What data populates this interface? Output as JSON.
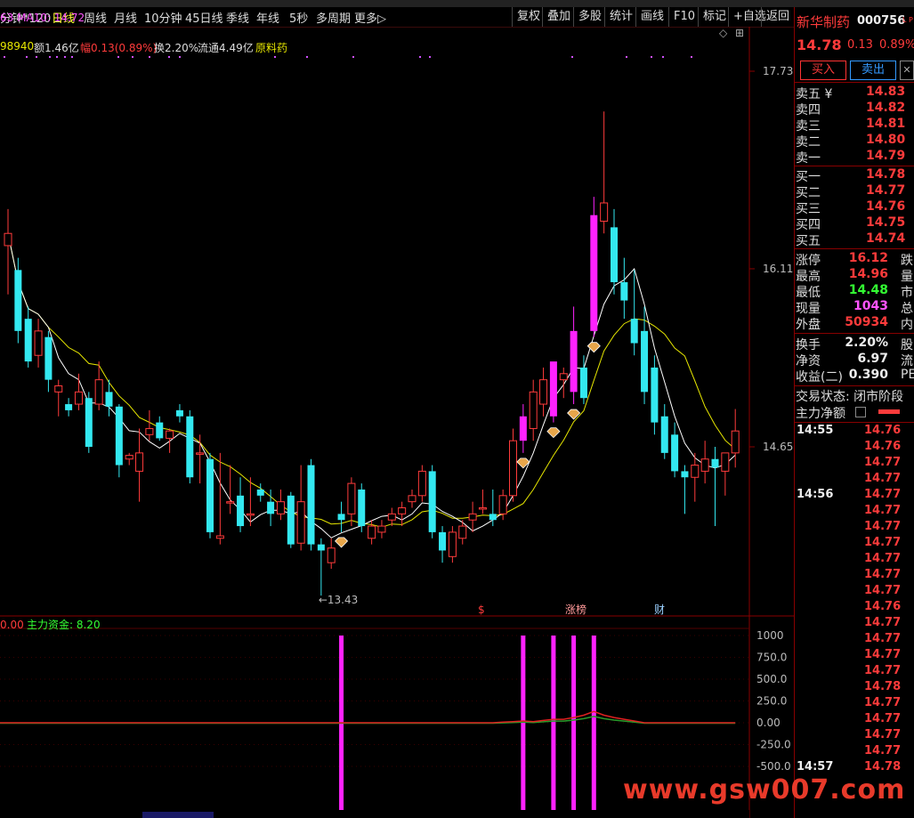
{
  "toolbar": {
    "periods": [
      "分钟*120",
      "日线",
      "周线",
      "月线",
      "10分钟",
      "45日线",
      "季线",
      "年线",
      "5秒",
      "多周期",
      "更多▷"
    ],
    "active_period": "日线",
    "right_buttons": [
      "复权",
      "叠加",
      "多股",
      "统计",
      "画线",
      "F10",
      "标记",
      "+自选",
      "返回"
    ]
  },
  "info": {
    "vol_fragment": "98940",
    "amount": "额1.46亿",
    "change": "幅0.13(0.89%)",
    "turnover": "换2.20%",
    "float": "流通4.49亿",
    "sector": "原料药",
    "ma_line": "63  MA10: 14.72",
    "diamond": "◇",
    "grid_icon": "⊞"
  },
  "main_chart": {
    "y_labels": [
      "17.73",
      "16.11",
      "14.65"
    ],
    "low_label": "←13.43",
    "markers": [
      "$",
      "涨榜",
      "财"
    ]
  },
  "indicator": {
    "header_left": "0.00",
    "header_name": "主力资金: 8.20",
    "y_labels": [
      "1000",
      "750.0",
      "500.0",
      "250.0",
      "0.00",
      "-250.0",
      "-500.0"
    ]
  },
  "stock": {
    "name": "新华制药",
    "code": "000756",
    "code_suffix": "L P",
    "price": "14.78",
    "change": "0.13",
    "change_pct": "0.89%",
    "buy_label": "买入",
    "sell_label": "卖出",
    "sells": [
      {
        "label": "卖五 ¥",
        "price": "14.83"
      },
      {
        "label": "卖四",
        "price": "14.82"
      },
      {
        "label": "卖三",
        "price": "14.81"
      },
      {
        "label": "卖二",
        "price": "14.80"
      },
      {
        "label": "卖一",
        "price": "14.79"
      }
    ],
    "buys": [
      {
        "label": "买一",
        "price": "14.78"
      },
      {
        "label": "买二",
        "price": "14.77"
      },
      {
        "label": "买三",
        "price": "14.76"
      },
      {
        "label": "买四",
        "price": "14.75"
      },
      {
        "label": "买五",
        "price": "14.74"
      }
    ],
    "stats": [
      {
        "label": "涨停",
        "value": "16.12",
        "tag": "跌"
      },
      {
        "label": "最高",
        "value": "14.96",
        "tag": "量"
      },
      {
        "label": "最低",
        "value": "14.48",
        "tag": "市"
      },
      {
        "label": "现量",
        "value": "1043",
        "tag": "总"
      },
      {
        "label": "外盘",
        "value": "50934",
        "tag": "内"
      }
    ],
    "stats2": [
      {
        "label": "换手",
        "value": "2.20%",
        "tag": "股"
      },
      {
        "label": "净资",
        "value": "6.97",
        "tag": "流"
      },
      {
        "label": "收益(二)",
        "value": "0.390",
        "tag": "PE"
      }
    ],
    "trade_status": "交易状态: 闭市阶段",
    "main_net": "主力净额"
  },
  "ticks": [
    {
      "time": "14:55",
      "price": "14.76"
    },
    {
      "time": "",
      "price": "14.76"
    },
    {
      "time": "",
      "price": "14.77"
    },
    {
      "time": "",
      "price": "14.77"
    },
    {
      "time": "14:56",
      "price": "14.77"
    },
    {
      "time": "",
      "price": "14.77"
    },
    {
      "time": "",
      "price": "14.77"
    },
    {
      "time": "",
      "price": "14.77"
    },
    {
      "time": "",
      "price": "14.77"
    },
    {
      "time": "",
      "price": "14.77"
    },
    {
      "time": "",
      "price": "14.77"
    },
    {
      "time": "",
      "price": "14.76"
    },
    {
      "time": "",
      "price": "14.77"
    },
    {
      "time": "",
      "price": "14.77"
    },
    {
      "time": "",
      "price": "14.77"
    },
    {
      "time": "",
      "price": "14.77"
    },
    {
      "time": "",
      "price": "14.78"
    },
    {
      "time": "",
      "price": "14.77"
    },
    {
      "time": "",
      "price": "14.77"
    },
    {
      "time": "",
      "price": "14.77"
    },
    {
      "time": "",
      "price": "14.77"
    },
    {
      "time": "14:57",
      "price": "14.78"
    }
  ],
  "watermark": "www.gsw007.com",
  "colors": {
    "up": "#ff3b3b",
    "down": "#33e8f0",
    "ma5": "#ffffff",
    "ma10": "#e6e600",
    "signal": "#ff22ff"
  },
  "chart_data": {
    "type": "candlestick",
    "y_axis_labels": [
      "17.73",
      "16.11",
      "14.65"
    ],
    "low_annotation": 13.43,
    "candles": [
      {
        "o": 16.3,
        "h": 16.6,
        "l": 15.9,
        "c": 16.4
      },
      {
        "o": 16.1,
        "h": 16.2,
        "l": 15.5,
        "c": 15.6
      },
      {
        "o": 15.7,
        "h": 15.8,
        "l": 15.3,
        "c": 15.35
      },
      {
        "o": 15.4,
        "h": 15.7,
        "l": 15.3,
        "c": 15.6
      },
      {
        "o": 15.55,
        "h": 15.6,
        "l": 15.1,
        "c": 15.2
      },
      {
        "o": 15.1,
        "h": 15.2,
        "l": 14.9,
        "c": 15.15
      },
      {
        "o": 15.0,
        "h": 15.05,
        "l": 14.9,
        "c": 14.95
      },
      {
        "o": 15.0,
        "h": 15.25,
        "l": 14.95,
        "c": 15.1
      },
      {
        "o": 15.05,
        "h": 15.1,
        "l": 14.6,
        "c": 14.65
      },
      {
        "o": 15.0,
        "h": 15.35,
        "l": 14.95,
        "c": 15.2
      },
      {
        "o": 15.1,
        "h": 15.2,
        "l": 14.9,
        "c": 14.98
      },
      {
        "o": 14.98,
        "h": 15.0,
        "l": 14.4,
        "c": 14.5
      },
      {
        "o": 14.55,
        "h": 14.6,
        "l": 14.5,
        "c": 14.58
      },
      {
        "o": 14.45,
        "h": 14.8,
        "l": 14.2,
        "c": 14.6
      },
      {
        "o": 14.75,
        "h": 14.95,
        "l": 14.7,
        "c": 14.8
      },
      {
        "o": 14.85,
        "h": 14.9,
        "l": 14.7,
        "c": 14.72
      },
      {
        "o": 14.72,
        "h": 14.8,
        "l": 14.6,
        "c": 14.78
      },
      {
        "o": 14.95,
        "h": 15.0,
        "l": 14.85,
        "c": 14.9
      },
      {
        "o": 14.9,
        "h": 14.95,
        "l": 14.35,
        "c": 14.4
      },
      {
        "o": 14.6,
        "h": 14.75,
        "l": 14.35,
        "c": 14.6
      },
      {
        "o": 14.55,
        "h": 14.6,
        "l": 13.9,
        "c": 13.95
      },
      {
        "o": 13.9,
        "h": 14.6,
        "l": 13.85,
        "c": 13.92
      },
      {
        "o": 14.2,
        "h": 14.5,
        "l": 14.1,
        "c": 14.2
      },
      {
        "o": 14.25,
        "h": 14.4,
        "l": 13.95,
        "c": 14.0
      },
      {
        "o": 14.1,
        "h": 14.4,
        "l": 14.0,
        "c": 14.1
      },
      {
        "o": 14.3,
        "h": 14.35,
        "l": 14.2,
        "c": 14.25
      },
      {
        "o": 14.2,
        "h": 14.3,
        "l": 14.0,
        "c": 14.1
      },
      {
        "o": 14.1,
        "h": 14.3,
        "l": 14.05,
        "c": 14.2
      },
      {
        "o": 14.25,
        "h": 14.28,
        "l": 13.82,
        "c": 13.85
      },
      {
        "o": 13.86,
        "h": 14.5,
        "l": 13.8,
        "c": 14.2
      },
      {
        "o": 14.5,
        "h": 14.55,
        "l": 13.8,
        "c": 13.85
      },
      {
        "o": 13.85,
        "h": 13.9,
        "l": 13.43,
        "c": 13.8
      },
      {
        "o": 13.7,
        "h": 13.9,
        "l": 13.65,
        "c": 13.82
      },
      {
        "o": 14.1,
        "h": 14.2,
        "l": 13.95,
        "c": 14.05
      },
      {
        "o": 14.1,
        "h": 14.4,
        "l": 14.0,
        "c": 14.35
      },
      {
        "o": 14.3,
        "h": 14.35,
        "l": 13.95,
        "c": 14.0
      },
      {
        "o": 13.9,
        "h": 14.05,
        "l": 13.85,
        "c": 14.0
      },
      {
        "o": 13.95,
        "h": 14.05,
        "l": 13.9,
        "c": 14.0
      },
      {
        "o": 14.05,
        "h": 14.15,
        "l": 14.0,
        "c": 14.1
      },
      {
        "o": 14.1,
        "h": 14.2,
        "l": 14.0,
        "c": 14.15
      },
      {
        "o": 14.2,
        "h": 14.3,
        "l": 14.15,
        "c": 14.25
      },
      {
        "o": 14.25,
        "h": 14.5,
        "l": 14.2,
        "c": 14.45
      },
      {
        "o": 14.45,
        "h": 14.5,
        "l": 13.9,
        "c": 13.95
      },
      {
        "o": 13.95,
        "h": 14.0,
        "l": 13.7,
        "c": 13.8
      },
      {
        "o": 13.75,
        "h": 14.0,
        "l": 13.7,
        "c": 13.95
      },
      {
        "o": 13.9,
        "h": 14.05,
        "l": 13.85,
        "c": 14.0
      },
      {
        "o": 14.05,
        "h": 14.2,
        "l": 13.95,
        "c": 14.1
      },
      {
        "o": 14.15,
        "h": 14.3,
        "l": 14.1,
        "c": 14.15
      },
      {
        "o": 14.1,
        "h": 14.3,
        "l": 14.0,
        "c": 14.05
      },
      {
        "o": 14.1,
        "h": 14.3,
        "l": 14.05,
        "c": 14.25
      },
      {
        "o": 14.25,
        "h": 14.8,
        "l": 14.2,
        "c": 14.7
      },
      {
        "o": 14.7,
        "h": 15.0,
        "l": 14.6,
        "c": 14.9
      },
      {
        "o": 14.8,
        "h": 15.2,
        "l": 14.7,
        "c": 15.1
      },
      {
        "o": 15.0,
        "h": 15.3,
        "l": 14.9,
        "c": 15.2
      },
      {
        "o": 14.9,
        "h": 15.3,
        "l": 14.85,
        "c": 15.35
      },
      {
        "o": 15.2,
        "h": 15.3,
        "l": 15.05,
        "c": 15.25
      },
      {
        "o": 15.1,
        "h": 15.8,
        "l": 15.0,
        "c": 15.6
      },
      {
        "o": 15.3,
        "h": 15.4,
        "l": 15.0,
        "c": 15.05
      },
      {
        "o": 15.6,
        "h": 16.7,
        "l": 15.55,
        "c": 16.55
      },
      {
        "o": 16.5,
        "h": 17.4,
        "l": 16.4,
        "c": 16.65
      },
      {
        "o": 16.45,
        "h": 16.6,
        "l": 15.9,
        "c": 16.0
      },
      {
        "o": 16.0,
        "h": 16.2,
        "l": 15.7,
        "c": 15.85
      },
      {
        "o": 15.7,
        "h": 16.1,
        "l": 15.4,
        "c": 15.5
      },
      {
        "o": 15.6,
        "h": 15.8,
        "l": 15.0,
        "c": 15.1
      },
      {
        "o": 15.3,
        "h": 15.4,
        "l": 14.75,
        "c": 14.85
      },
      {
        "o": 14.9,
        "h": 15.0,
        "l": 14.55,
        "c": 14.6
      },
      {
        "o": 14.75,
        "h": 14.85,
        "l": 14.4,
        "c": 14.45
      },
      {
        "o": 14.45,
        "h": 14.5,
        "l": 14.1,
        "c": 14.4
      },
      {
        "o": 14.4,
        "h": 14.6,
        "l": 14.2,
        "c": 14.5
      },
      {
        "o": 14.45,
        "h": 14.7,
        "l": 14.35,
        "c": 14.55
      },
      {
        "o": 14.55,
        "h": 14.65,
        "l": 14.0,
        "c": 14.48
      },
      {
        "o": 14.45,
        "h": 14.6,
        "l": 14.25,
        "c": 14.6
      },
      {
        "o": 14.6,
        "h": 14.96,
        "l": 14.48,
        "c": 14.78
      }
    ],
    "signal_bars": [
      {
        "index": 33,
        "value": 1000
      },
      {
        "index": 51,
        "value": 1000
      },
      {
        "index": 54,
        "value": 1000
      },
      {
        "index": 56,
        "value": 1000
      },
      {
        "index": 58,
        "value": 1000
      }
    ],
    "diamonds": [
      33,
      51,
      54,
      56,
      58
    ],
    "main_capital_line": [
      {
        "index": 51,
        "value": 20
      },
      {
        "index": 54,
        "value": 40
      },
      {
        "index": 56,
        "value": 60
      },
      {
        "index": 58,
        "value": 130
      },
      {
        "index": 60,
        "value": 60
      }
    ],
    "indicator_ylim": [
      -500,
      1000
    ],
    "price_ylim": [
      13.2,
      17.9
    ]
  }
}
